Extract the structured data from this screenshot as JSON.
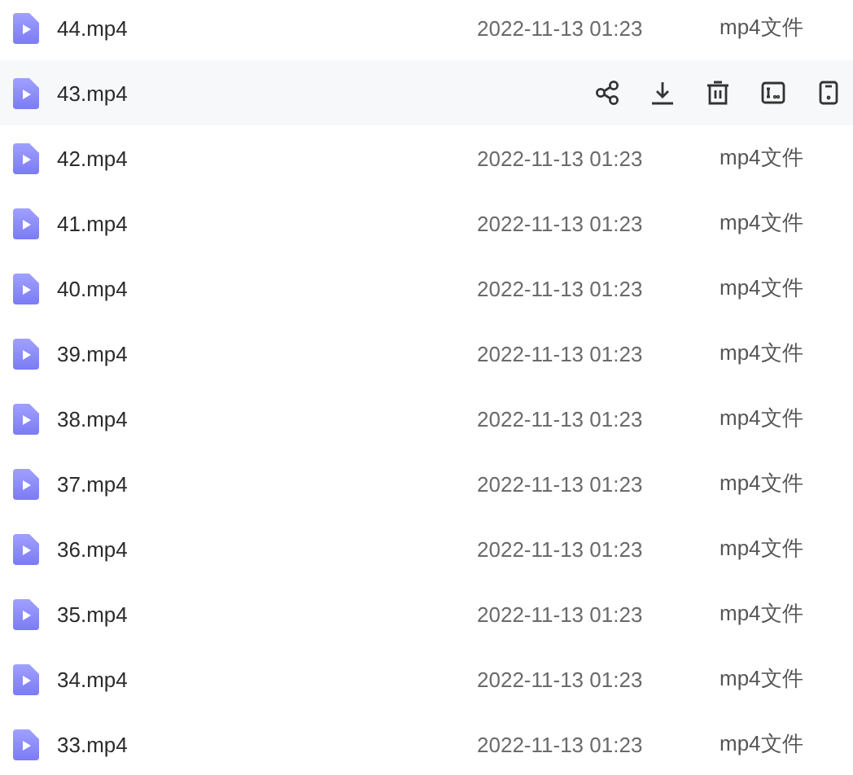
{
  "files": [
    {
      "name": "44.mp4",
      "date": "2022-11-13 01:23",
      "type": "mp4文件",
      "hovered": false
    },
    {
      "name": "43.mp4",
      "hovered": true
    },
    {
      "name": "42.mp4",
      "date": "2022-11-13 01:23",
      "type": "mp4文件",
      "hovered": false
    },
    {
      "name": "41.mp4",
      "date": "2022-11-13 01:23",
      "type": "mp4文件",
      "hovered": false
    },
    {
      "name": "40.mp4",
      "date": "2022-11-13 01:23",
      "type": "mp4文件",
      "hovered": false
    },
    {
      "name": "39.mp4",
      "date": "2022-11-13 01:23",
      "type": "mp4文件",
      "hovered": false
    },
    {
      "name": "38.mp4",
      "date": "2022-11-13 01:23",
      "type": "mp4文件",
      "hovered": false
    },
    {
      "name": "37.mp4",
      "date": "2022-11-13 01:23",
      "type": "mp4文件",
      "hovered": false
    },
    {
      "name": "36.mp4",
      "date": "2022-11-13 01:23",
      "type": "mp4文件",
      "hovered": false
    },
    {
      "name": "35.mp4",
      "date": "2022-11-13 01:23",
      "type": "mp4文件",
      "hovered": false
    },
    {
      "name": "34.mp4",
      "date": "2022-11-13 01:23",
      "type": "mp4文件",
      "hovered": false
    },
    {
      "name": "33.mp4",
      "date": "2022-11-13 01:23",
      "type": "mp4文件",
      "hovered": false
    }
  ]
}
